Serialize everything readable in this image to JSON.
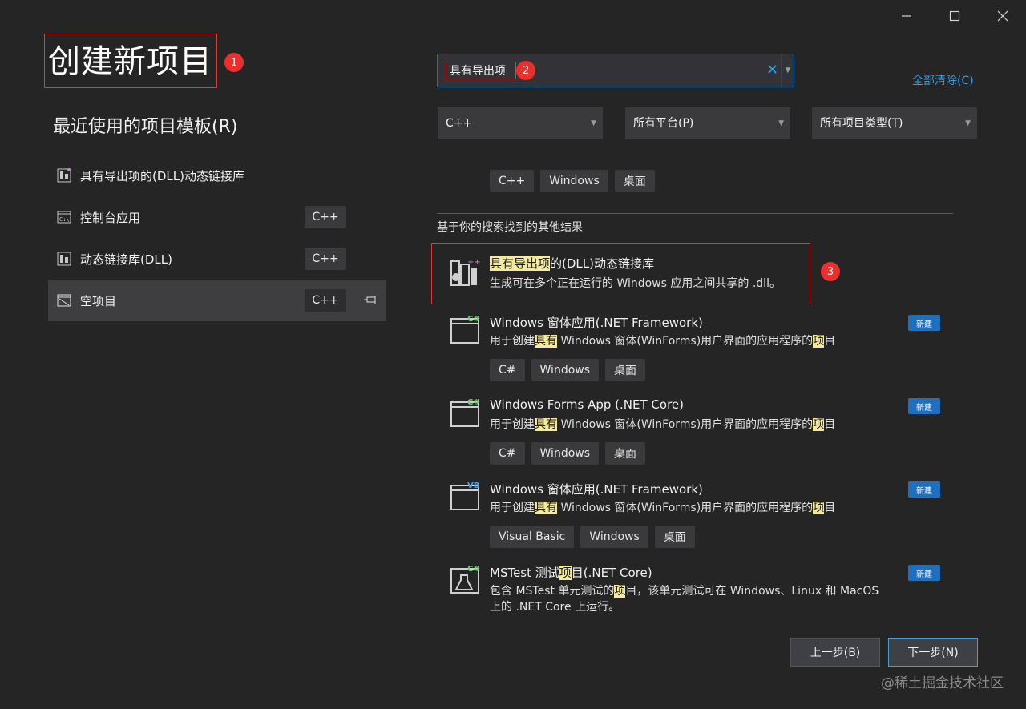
{
  "title": "创建新项目",
  "annotations": [
    "1",
    "2",
    "3"
  ],
  "recent": {
    "heading": "最近使用的项目模板(R)",
    "items": [
      {
        "label": "具有导出项的(DLL)动态链接库",
        "tag": "",
        "icon": "dll-export-icon"
      },
      {
        "label": "控制台应用",
        "tag": "C++",
        "icon": "console-app-icon"
      },
      {
        "label": "动态链接库(DLL)",
        "tag": "C++",
        "icon": "dll-icon"
      },
      {
        "label": "空项目",
        "tag": "C++",
        "icon": "empty-project-icon",
        "selected": true
      }
    ]
  },
  "search": {
    "value": "具有导出项",
    "clear_all": "全部清除(C)"
  },
  "filters": {
    "language": "C++",
    "platform": "所有平台(P)",
    "project_type": "所有项目类型(T)"
  },
  "partial_result": {
    "tags": [
      "C++",
      "Windows",
      "桌面"
    ]
  },
  "other_results_label": "基于你的搜索找到的其他结果",
  "results": [
    {
      "title_hl": "具有导出项",
      "title_rest": "的(DLL)动态链接库",
      "desc": "生成可在多个正在运行的 Windows 应用之间共享的 .dll。",
      "icon": "dll-export-icon",
      "tags": [],
      "new": ""
    },
    {
      "title": "Windows 窗体应用(.NET Framework)",
      "desc_parts": [
        "用于创建",
        "具有",
        " Windows 窗体(WinForms)用户界面的应用程序的",
        "项",
        "目"
      ],
      "icon": "csharp-window-icon",
      "tags": [
        "C#",
        "Windows",
        "桌面"
      ],
      "new": "新建"
    },
    {
      "title": "Windows Forms App (.NET Core)",
      "desc_parts": [
        "用于创建",
        "具有",
        " Windows 窗体(WinForms)用户界面的应用程序的",
        "项",
        "目"
      ],
      "icon": "csharp-window-icon",
      "tags": [
        "C#",
        "Windows",
        "桌面"
      ],
      "new": "新建"
    },
    {
      "title": "Windows 窗体应用(.NET Framework)",
      "desc_parts": [
        "用于创建",
        "具有",
        " Windows 窗体(WinForms)用户界面的应用程序的",
        "项",
        "目"
      ],
      "icon": "vb-window-icon",
      "tags": [
        "Visual Basic",
        "Windows",
        "桌面"
      ],
      "new": "新建"
    },
    {
      "title_parts": [
        "MSTest 测试",
        "项",
        "目(.NET Core)"
      ],
      "desc_parts": [
        "包含 MSTest 单元测试的",
        "项",
        "目，该单元测试可在 Windows、Linux 和 MacOS"
      ],
      "desc_line2": "上的 .NET Core 上运行。",
      "icon": "mstest-flask-icon",
      "tags": [],
      "new": "新建"
    }
  ],
  "buttons": {
    "back": "上一步(B)",
    "next": "下一步(N)"
  },
  "watermark": "@稀土掘金技术社区",
  "colors": {
    "accent": "#007acc",
    "link": "#3c9de0",
    "highlight": "#f5eb9a",
    "annotation": "#e8302d",
    "background": "#252526"
  }
}
